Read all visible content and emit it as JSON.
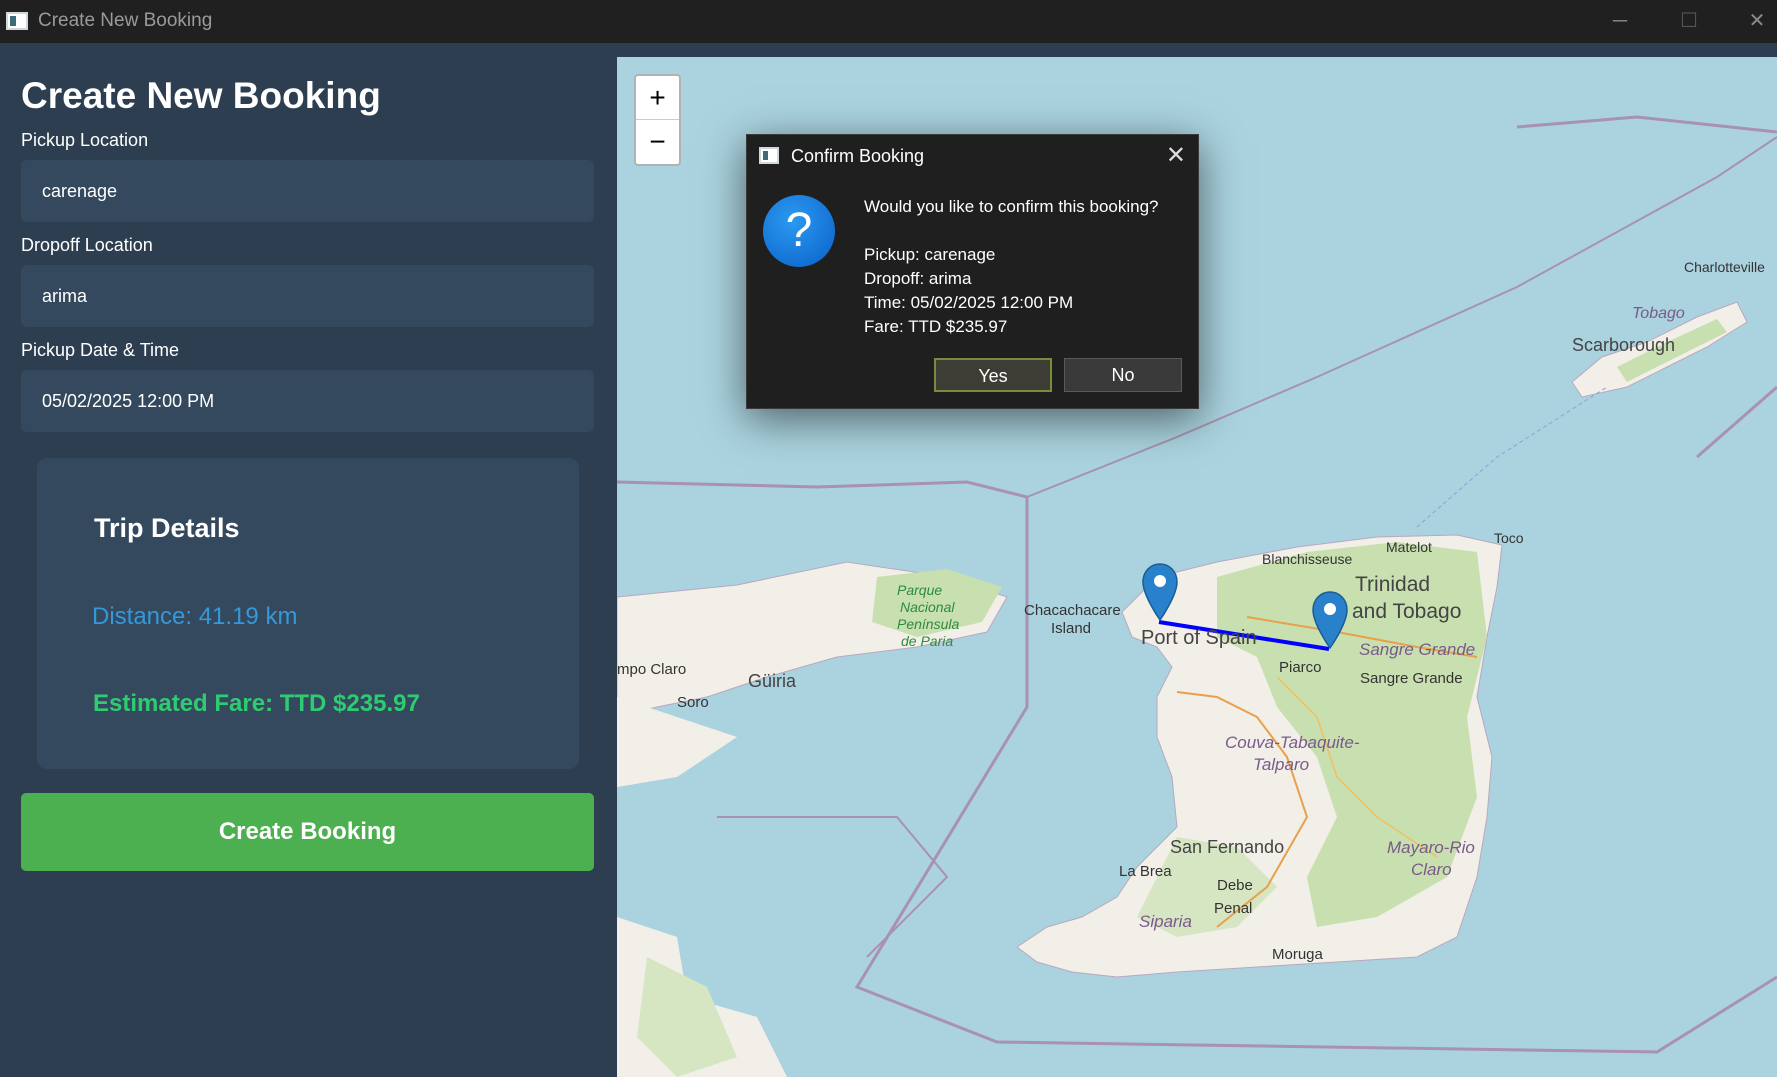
{
  "window": {
    "title": "Create New Booking",
    "minimize": "─",
    "maximize": "☐",
    "close": "✕"
  },
  "form": {
    "heading": "Create New Booking",
    "pickup_label": "Pickup Location",
    "pickup_value": "carenage",
    "dropoff_label": "Dropoff Location",
    "dropoff_value": "arima",
    "datetime_label": "Pickup Date & Time",
    "datetime_value": "05/02/2025 12:00 PM"
  },
  "trip": {
    "title": "Trip Details",
    "distance": "Distance: 41.19 km",
    "fare": "Estimated Fare: TTD $235.97"
  },
  "create_button": "Create Booking",
  "map": {
    "zoom_in": "+",
    "zoom_out": "−",
    "labels": {
      "charlotteville": "Charlotteville",
      "tobago": "Tobago",
      "scarborough": "Scarborough",
      "matelot": "Matelot",
      "toco": "Toco",
      "blanchisseuse": "Blanchisseuse",
      "trinidad_line1": "Trinidad",
      "trinidad_line2": "and Tobago",
      "chacachacare_line1": "Chacachacare",
      "chacachacare_line2": "Island",
      "port_of_spain": "Port of Spain",
      "sangre_grande_region": "Sangre Grande",
      "piarco": "Piarco",
      "sangre_grande_town": "Sangre Grande",
      "park_line1": "Parque",
      "park_line2": "Nacional",
      "park_line3": "Península",
      "park_line4": "de Paria",
      "guiria": "Güiria",
      "campo_claro": "mpo Claro",
      "soro": "Soro",
      "couva_line1": "Couva-Tabaquite-",
      "couva_line2": "Talparo",
      "san_fernando": "San Fernando",
      "mayaro_line1": "Mayaro-Rio",
      "mayaro_line2": "Claro",
      "la_brea": "La Brea",
      "debe": "Debe",
      "penal": "Penal",
      "siparia": "Siparia",
      "moruga": "Moruga"
    }
  },
  "dialog": {
    "title": "Confirm Booking",
    "close": "✕",
    "question_icon": "?",
    "question": "Would you like to confirm this booking?",
    "pickup": "Pickup: carenage",
    "dropoff": "Dropoff: arima",
    "time": "Time: 05/02/2025 12:00 PM",
    "fare": "Fare: TTD $235.97",
    "yes": "Yes",
    "no": "No"
  },
  "colors": {
    "panel_bg": "#2c3e50",
    "field_bg": "#34495e",
    "distance_text": "#3498db",
    "fare_text": "#2ecc71",
    "create_button_bg": "#4caf50",
    "route_line": "#0000ff",
    "map_water": "#aad3df"
  }
}
